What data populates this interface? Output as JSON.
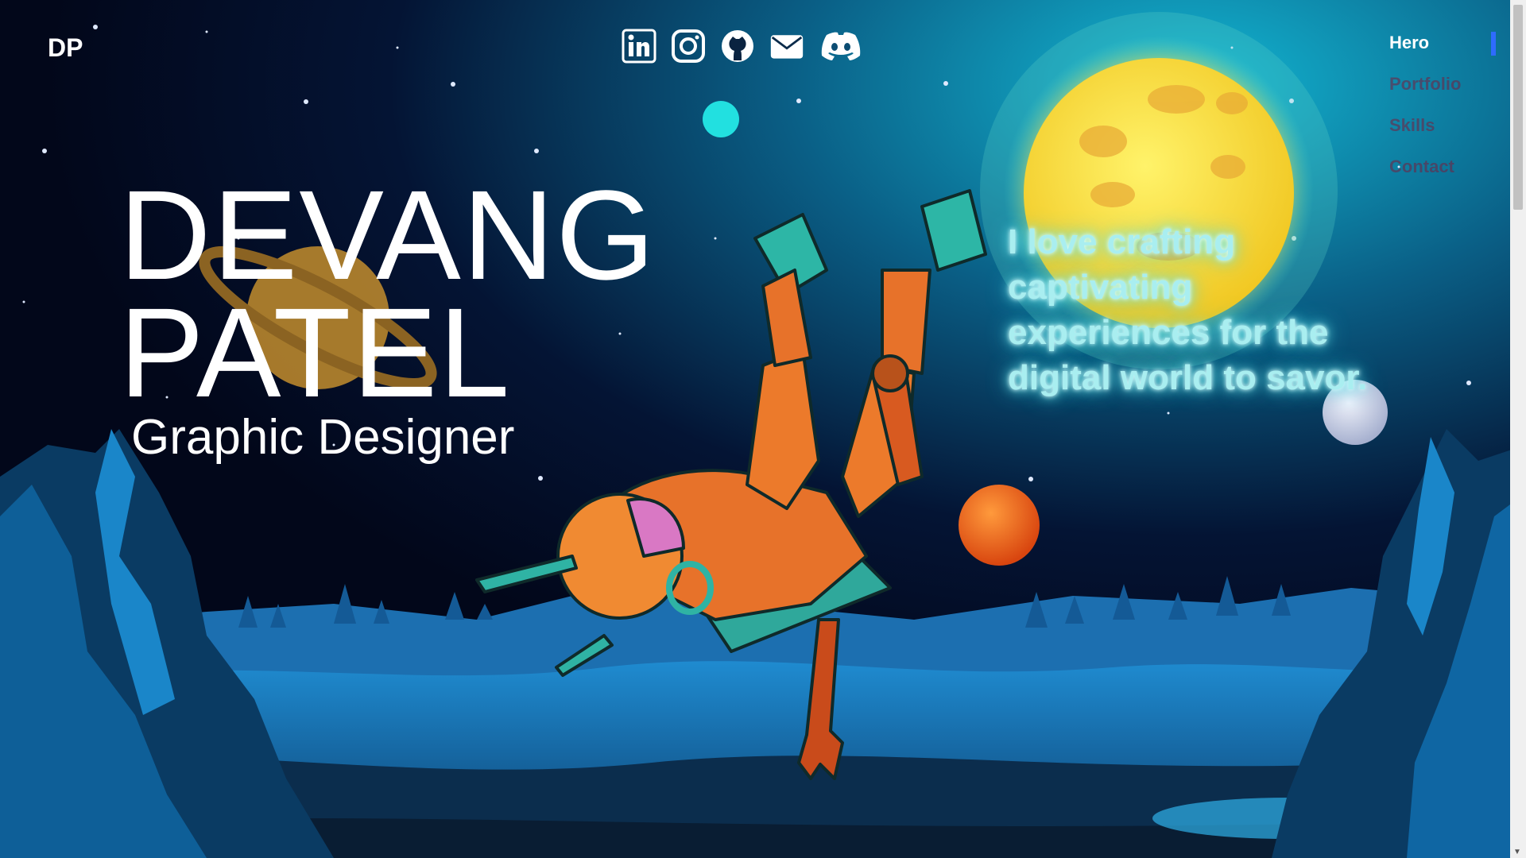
{
  "header": {
    "logo": "DP"
  },
  "socials": [
    {
      "name": "linkedin-icon"
    },
    {
      "name": "instagram-icon"
    },
    {
      "name": "github-icon"
    },
    {
      "name": "email-icon"
    },
    {
      "name": "discord-icon"
    }
  ],
  "nav": {
    "items": [
      {
        "label": "Hero",
        "active": true
      },
      {
        "label": "Portfolio",
        "active": false
      },
      {
        "label": "Skills",
        "active": false
      },
      {
        "label": "Contact",
        "active": false
      }
    ]
  },
  "hero": {
    "first_name": "DEVANG",
    "last_name": "PATEL",
    "role": "Graphic Designer",
    "tagline": "I love crafting captivating experiences for the digital world to savor."
  },
  "colors": {
    "accent": "#2f6bff",
    "tagline_glow": "#7df3f6",
    "moon": "#f5d93a",
    "sky_top": "#02081a",
    "sky_glow": "#0f8fb0"
  }
}
